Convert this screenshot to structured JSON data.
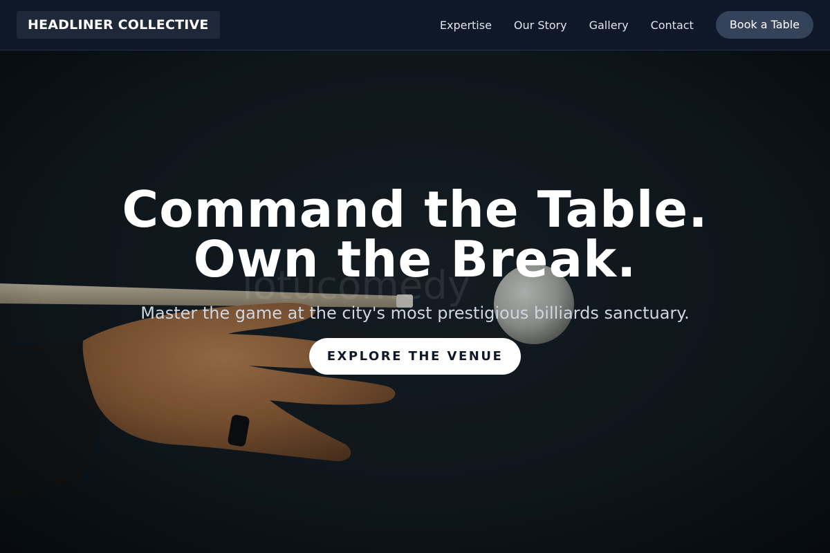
{
  "header": {
    "brand": "HEADLINER COLLECTIVE",
    "nav": [
      "Expertise",
      "Our Story",
      "Gallery",
      "Contact"
    ],
    "cta": "Book a Table"
  },
  "hero": {
    "image": "hand lining up a cue stick behind a white cue ball on dark felt",
    "watermark": "lotucomedy",
    "headline": [
      "Command the Table.",
      "Own the Break."
    ],
    "subheadline": "Master the game at the city's most prestigious billiards sanctuary.",
    "cta": "EXPLORE THE VENUE"
  },
  "colors": {
    "header_bg": "#0f1829",
    "book_button_bg": "#34435a",
    "hero_bg": "#111a1f",
    "cta_bg": "#ffffff",
    "cta_text": "#111827"
  }
}
